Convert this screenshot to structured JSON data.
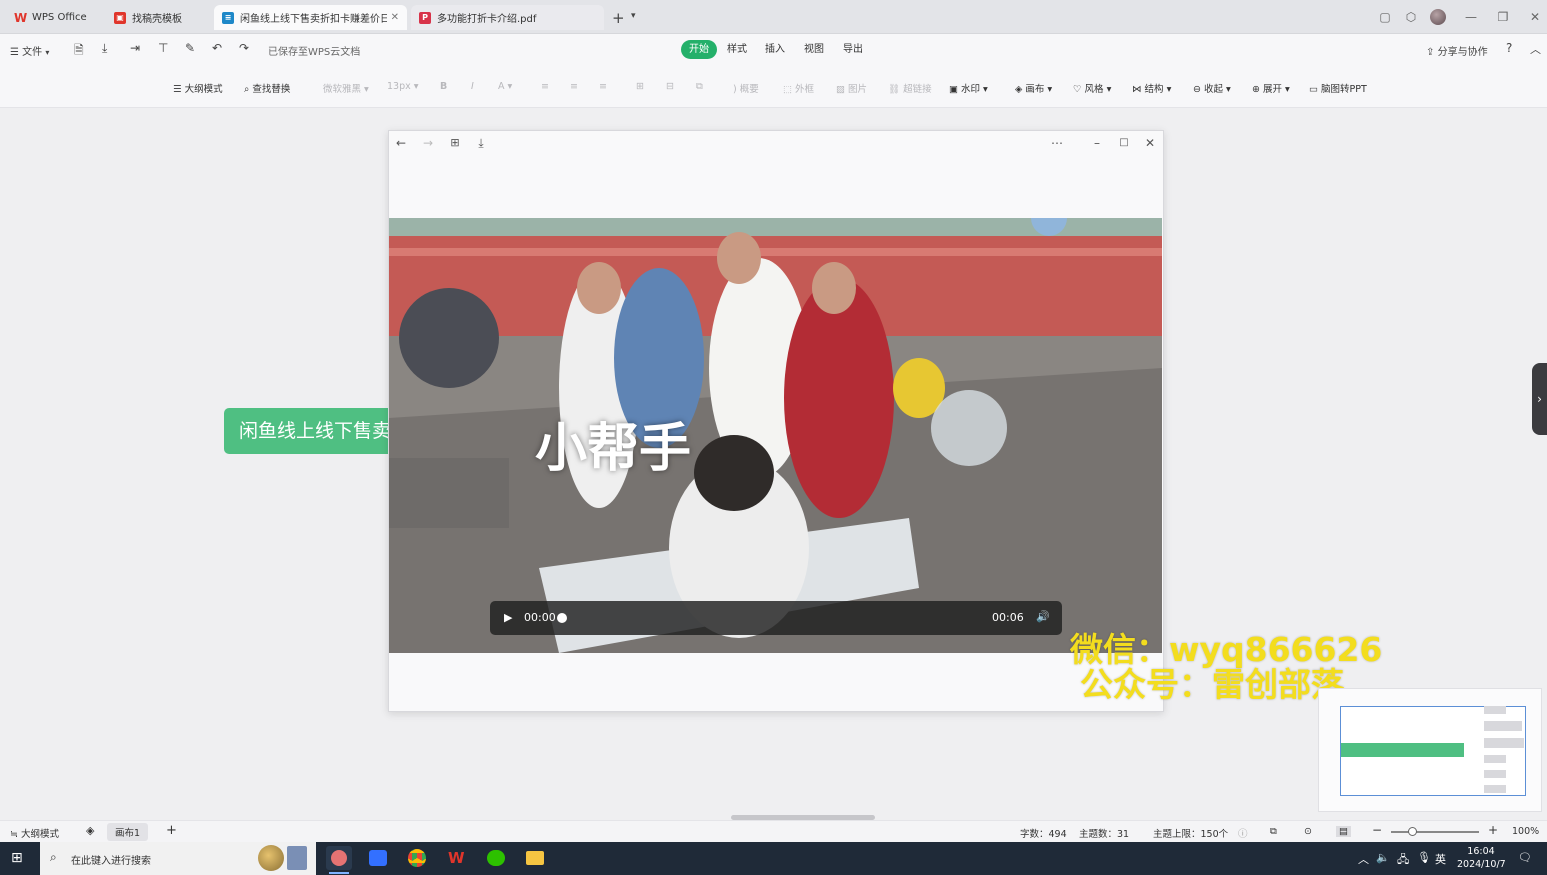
{
  "tabs": [
    {
      "label": "WPS Office",
      "icon": "wps-logo-icon"
    },
    {
      "label": "找稿壳模板",
      "icon": "template-icon"
    },
    {
      "label": "闲鱼线上线下售卖折扣卡赚差价日...",
      "icon": "mindmap-file-icon",
      "active": true
    },
    {
      "label": "多功能打折卡介绍.pdf",
      "icon": "pdf-icon"
    }
  ],
  "menu": {
    "file_label": "文件",
    "saved_status": "已保存至WPS云文档",
    "tabs": [
      "开始",
      "样式",
      "插入",
      "视图",
      "导出"
    ],
    "active_tab": "开始",
    "share_label": "分享与协作"
  },
  "toolbar": {
    "outline_mode": "大纲模式",
    "find_replace": "查找替换",
    "font_name": "微软雅黑",
    "font_size": "13px",
    "summary": "概要",
    "outer_frame": "外框",
    "image": "图片",
    "hyperlink": "超链接",
    "watermark": "水印",
    "canvas": "画布",
    "style": "风格",
    "structure": "结构",
    "collapse": "收起",
    "expand": "展开",
    "to_ppt": "脑图转PPT"
  },
  "canvas": {
    "node_text": "闲鱼线上线下售卖"
  },
  "video": {
    "overlay_text": "小帮手",
    "current_time": "00:00",
    "duration": "00:06",
    "progress": 0.0
  },
  "watermark": {
    "line1": "微信：wyq866626",
    "line2": "公众号：雷创部落"
  },
  "status": {
    "outline_mode": "大纲模式",
    "sheet_tab": "画布1",
    "word_count": "字数：494",
    "topic_count": "主题数：31",
    "topic_limit": "主题上限：150个",
    "zoom": "100%"
  },
  "taskbar": {
    "search_placeholder": "在此键入进行搜索",
    "ime": "英",
    "time": "16:04",
    "date": "2024/10/7"
  },
  "colors": {
    "accent_green": "#24b06a",
    "node_green": "#4fbf82",
    "watermark_yellow": "#f3dd1e",
    "taskbar": "#1f2a38"
  }
}
